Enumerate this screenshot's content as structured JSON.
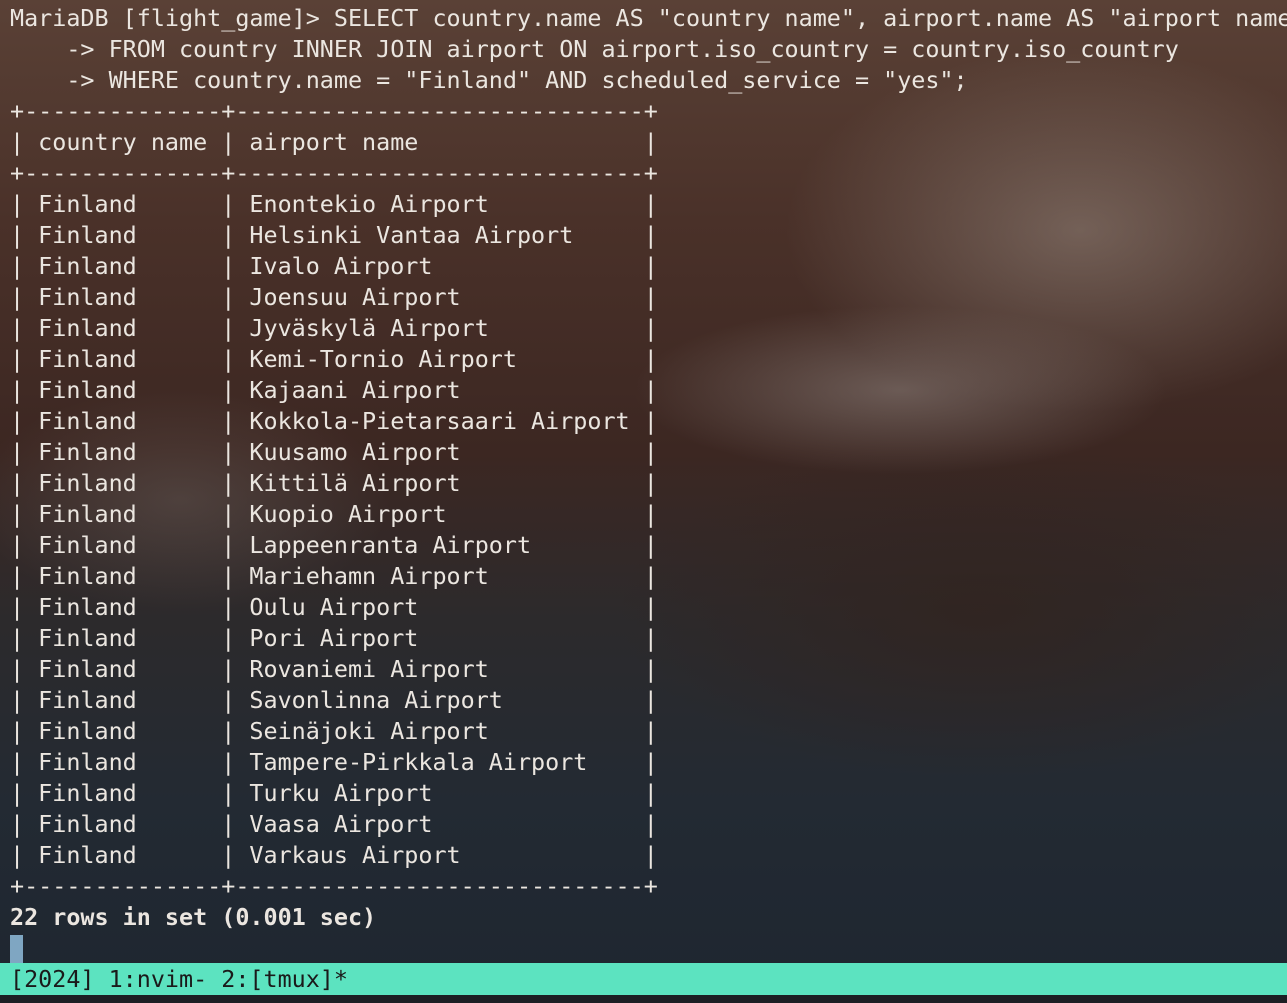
{
  "terminal": {
    "prompt_lines": [
      "MariaDB [flight_game]> SELECT country.name AS \"country name\", airport.name AS \"airport name\"",
      "    -> FROM country INNER JOIN airport ON airport.iso_country = country.iso_country",
      "    -> WHERE country.name = \"Finland\" AND scheduled_service = \"yes\";"
    ],
    "table": {
      "border": "+--------------+-----------------------------+",
      "header": "| country name | airport name                |",
      "rows": [
        "| Finland      | Enontekio Airport           |",
        "| Finland      | Helsinki Vantaa Airport     |",
        "| Finland      | Ivalo Airport               |",
        "| Finland      | Joensuu Airport             |",
        "| Finland      | Jyväskylä Airport           |",
        "| Finland      | Kemi-Tornio Airport         |",
        "| Finland      | Kajaani Airport             |",
        "| Finland      | Kokkola-Pietarsaari Airport |",
        "| Finland      | Kuusamo Airport             |",
        "| Finland      | Kittilä Airport             |",
        "| Finland      | Kuopio Airport              |",
        "| Finland      | Lappeenranta Airport        |",
        "| Finland      | Mariehamn Airport           |",
        "| Finland      | Oulu Airport                |",
        "| Finland      | Pori Airport                |",
        "| Finland      | Rovaniemi Airport           |",
        "| Finland      | Savonlinna Airport          |",
        "| Finland      | Seinäjoki Airport           |",
        "| Finland      | Tampere-Pirkkala Airport    |",
        "| Finland      | Turku Airport               |",
        "| Finland      | Vaasa Airport               |",
        "| Finland      | Varkaus Airport             |"
      ]
    },
    "result_summary": "22 rows in set (0.001 sec)"
  },
  "statusbar": {
    "text": "[2024] 1:nvim- 2:[tmux]*"
  },
  "colors": {
    "statusbar_bg": "#5ce3c0",
    "cursor": "#7fa6c2",
    "text": "#ebe6e0"
  }
}
